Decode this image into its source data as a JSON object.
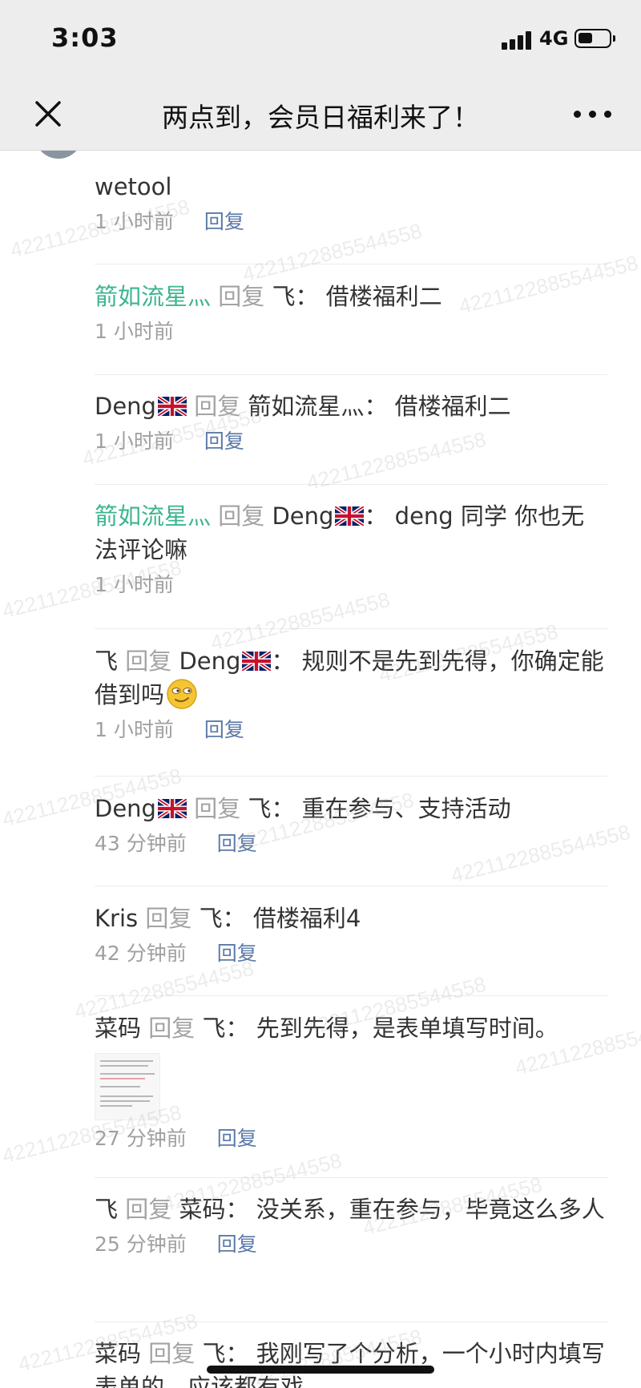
{
  "status_bar": {
    "time": "3:03",
    "network": "4G"
  },
  "nav": {
    "title": "两点到，会员日福利来了！"
  },
  "watermark_text": "4221122885544558",
  "comments": [
    {
      "content": "wetool",
      "time": "1 小时前",
      "reply_label": "回复"
    },
    {
      "author": "箭如流星灬",
      "reply_word": "回复",
      "target": "飞",
      "sep": "：",
      "content": "借楼福利二",
      "time": "1 小时前"
    },
    {
      "author": "Deng",
      "author_flag": "uk-flag-icon",
      "reply_word": "回复",
      "target": "箭如流星灬",
      "sep": "：",
      "content": "借楼福利二",
      "time": "1 小时前",
      "reply_label": "回复"
    },
    {
      "author": "箭如流星灬",
      "reply_word": "回复",
      "target": "Deng",
      "target_flag": "uk-flag-icon",
      "sep": "：",
      "content": "deng 同学 你也无法评论嘛",
      "time": "1 小时前"
    },
    {
      "author": "飞",
      "reply_word": "回复",
      "target": "Deng",
      "target_flag": "uk-flag-icon",
      "sep": "：",
      "content": "规则不是先到先得，你确定能借到吗",
      "emoji": "smirk-emoji-icon",
      "time": "1 小时前",
      "reply_label": "回复"
    },
    {
      "author": "Deng",
      "author_flag": "uk-flag-icon",
      "reply_word": "回复",
      "target": "飞",
      "sep": "：",
      "content": "重在参与、支持活动",
      "time": "43 分钟前",
      "reply_label": "回复"
    },
    {
      "author": "Kris",
      "reply_word": "回复",
      "target": "飞",
      "sep": "：",
      "content": "借楼福利4",
      "time": "42 分钟前",
      "reply_label": "回复"
    },
    {
      "author": "菜码",
      "reply_word": "回复",
      "target": "飞",
      "sep": "：",
      "content": "先到先得，是表单填写时间。",
      "has_image": true,
      "time": "27 分钟前",
      "reply_label": "回复"
    },
    {
      "author": "飞",
      "reply_word": "回复",
      "target": "菜码",
      "sep": "：",
      "content": "没关系，重在参与，毕竟这么多人",
      "time": "25 分钟前",
      "reply_label": "回复"
    },
    {
      "author": "菜码",
      "reply_word": "回复",
      "target": "飞",
      "sep": "：",
      "content": "我刚写了个分析，一个小时内填写表单的，应该都有戏"
    }
  ]
}
